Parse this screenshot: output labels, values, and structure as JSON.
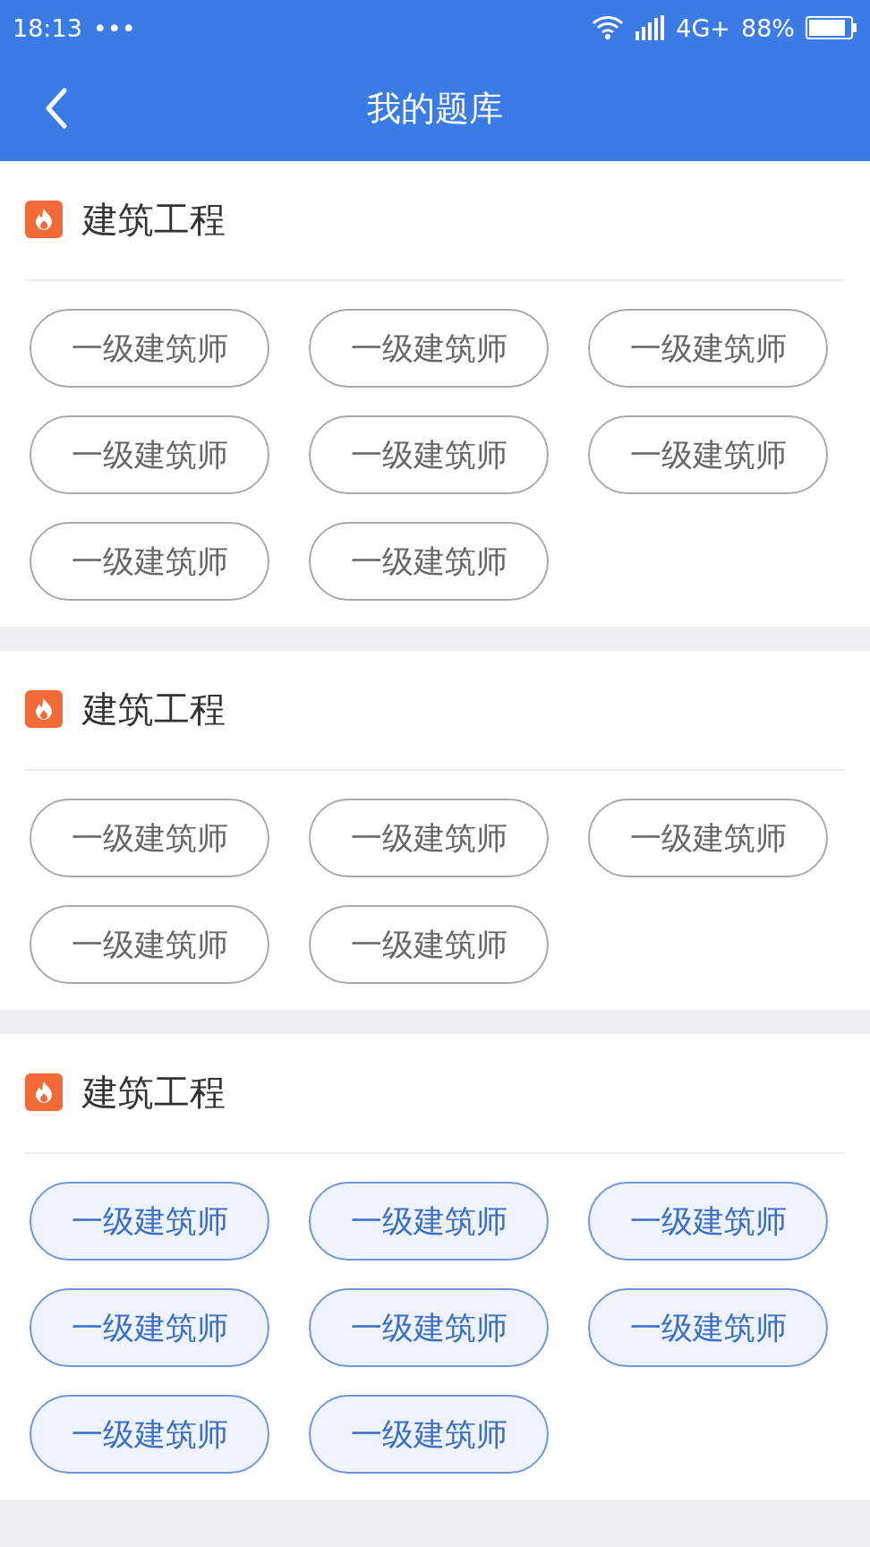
{
  "status_bar": {
    "time": "18:13",
    "dots": "•••",
    "network": "4G+",
    "battery": "88%"
  },
  "header": {
    "title": "我的题库"
  },
  "sections": [
    {
      "title": "建筑工程",
      "items": [
        {
          "label": "一级建筑师",
          "selected": false
        },
        {
          "label": "一级建筑师",
          "selected": false
        },
        {
          "label": "一级建筑师",
          "selected": false
        },
        {
          "label": "一级建筑师",
          "selected": false
        },
        {
          "label": "一级建筑师",
          "selected": false
        },
        {
          "label": "一级建筑师",
          "selected": false
        },
        {
          "label": "一级建筑师",
          "selected": false
        },
        {
          "label": "一级建筑师",
          "selected": false
        }
      ]
    },
    {
      "title": "建筑工程",
      "items": [
        {
          "label": "一级建筑师",
          "selected": false
        },
        {
          "label": "一级建筑师",
          "selected": false
        },
        {
          "label": "一级建筑师",
          "selected": false
        },
        {
          "label": "一级建筑师",
          "selected": false
        },
        {
          "label": "一级建筑师",
          "selected": false
        }
      ]
    },
    {
      "title": "建筑工程",
      "items": [
        {
          "label": "一级建筑师",
          "selected": true
        },
        {
          "label": "一级建筑师",
          "selected": true
        },
        {
          "label": "一级建筑师",
          "selected": true
        },
        {
          "label": "一级建筑师",
          "selected": true
        },
        {
          "label": "一级建筑师",
          "selected": true
        },
        {
          "label": "一级建筑师",
          "selected": true
        },
        {
          "label": "一级建筑师",
          "selected": true
        },
        {
          "label": "一级建筑师",
          "selected": true
        }
      ]
    }
  ]
}
